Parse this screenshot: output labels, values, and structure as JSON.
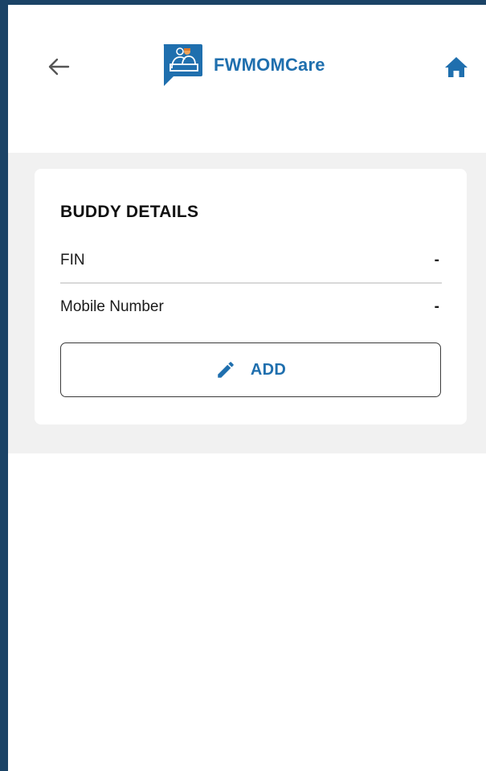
{
  "app": {
    "title": "FWMOMCare"
  },
  "header": {
    "back_icon": "arrow-left-icon",
    "logo_icon": "chat-people-logo-icon",
    "home_icon": "home-icon"
  },
  "card": {
    "title": "BUDDY DETAILS",
    "rows": [
      {
        "label": "FIN",
        "value": "-"
      },
      {
        "label": "Mobile Number",
        "value": "-"
      }
    ],
    "add_button": {
      "label": "ADD",
      "icon": "pencil-icon"
    }
  },
  "colors": {
    "brand": "#1f6fae",
    "frame_border": "#1b4366",
    "content_bg": "#f1f1f1",
    "card_bg": "#ffffff"
  }
}
